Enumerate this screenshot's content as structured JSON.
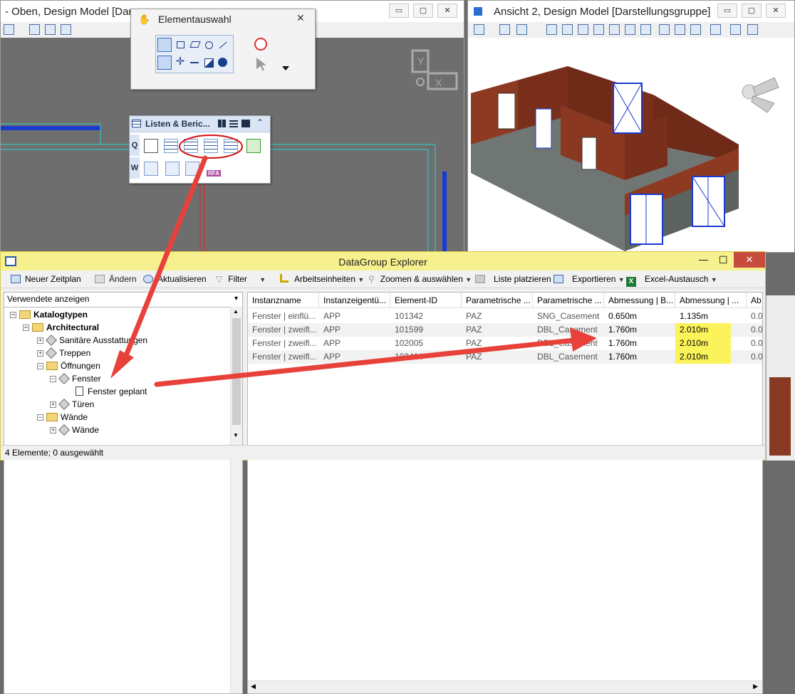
{
  "window_top": {
    "title": "- Oben, Design Model [Dars",
    "min": "▭",
    "max": "▢",
    "close": "✕"
  },
  "window_view2": {
    "title": "Ansicht 2, Design Model [Darstellungsgruppe]",
    "min": "▭",
    "max": "▢",
    "close": "✕"
  },
  "element_selection": {
    "title": "Elementauswahl",
    "close": "✕"
  },
  "lists_panel": {
    "title": "Listen & Beric...",
    "row_q": "Q",
    "row_w": "W",
    "rfa": "RFA"
  },
  "datagroup": {
    "title": "DataGroup Explorer",
    "min": "—",
    "max": "☐",
    "close": "✕",
    "toolbar": {
      "new_schedule": "Neuer Zeitplan",
      "change": "Ändern",
      "refresh": "Aktualisieren",
      "filter": "Filter",
      "working_units": "Arbeitseinheiten",
      "zoom_select": "Zoomen & auswählen",
      "place_list": "Liste platzieren",
      "export": "Exportieren",
      "excel": "Excel-Austausch"
    },
    "combo": "Verwendete anzeigen",
    "tree": [
      {
        "label": "Katalogtypen",
        "bold": true
      },
      {
        "label": "Architectural",
        "bold": true
      },
      {
        "label": "Sanitäre Ausstattungen",
        "bold": false
      },
      {
        "label": "Treppen",
        "bold": false
      },
      {
        "label": "Öffnungen",
        "bold": false
      },
      {
        "label": "Fenster",
        "bold": false
      },
      {
        "label": "Fenster geplant",
        "bold": false
      },
      {
        "label": "Türen",
        "bold": false
      },
      {
        "label": "Wände",
        "bold": false
      },
      {
        "label": "Wände",
        "bold": false
      }
    ],
    "columns": [
      "Instanzname",
      "Instanzeigentü...",
      "Element-ID",
      "Parametrische ...",
      "Parametrische ...",
      "Abmessung | B...",
      "Abmessung | ...",
      "Ab"
    ],
    "rows": [
      [
        "Fenster | einflü...",
        "APP",
        "101342",
        "PAZ",
        "SNG_Casement",
        "0.650m",
        "1.135m",
        "0.0"
      ],
      [
        "Fenster | zweifl...",
        "APP",
        "101599",
        "PAZ",
        "DBL_Casement",
        "1.760m",
        "2.010m",
        "0.0"
      ],
      [
        "Fenster | zweifl...",
        "APP",
        "102005",
        "PAZ",
        "DBL_Casement",
        "1.760m",
        "2.010m",
        "0.0"
      ],
      [
        "Fenster | zweifl...",
        "APP",
        "102414",
        "PAZ",
        "DBL_Casement",
        "1.760m",
        "2.010m",
        "0.0"
      ]
    ],
    "status": "4 Elemente; 0 ausgewählt"
  },
  "colors": {
    "arrow": "#e8413a",
    "highlight": "#fbf35a",
    "titlebar_dg": "#f7f08e",
    "brick": "#7a2f1c"
  }
}
